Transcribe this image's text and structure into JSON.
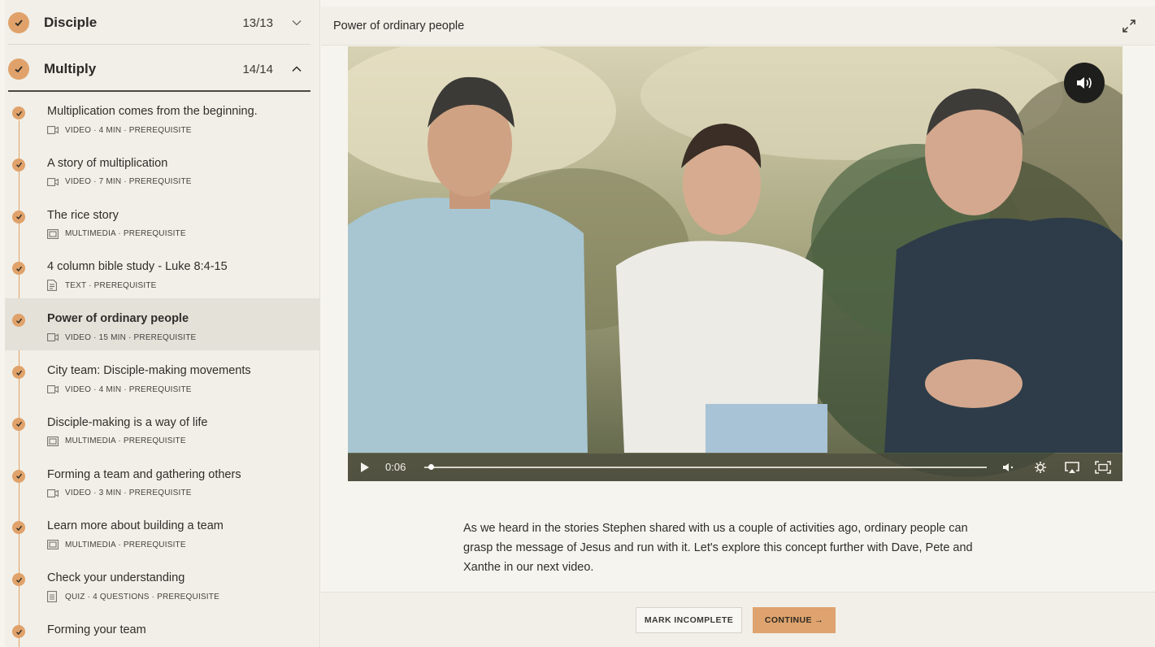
{
  "sidebar": {
    "sections": [
      {
        "title": "Disciple",
        "count": "13/13",
        "expanded": false
      },
      {
        "title": "Multiply",
        "count": "14/14",
        "expanded": true
      }
    ],
    "lessons": [
      {
        "title": "Multiplication comes from the beginning.",
        "meta": "VIDEO · 4 MIN · PREREQUISITE",
        "icon": "video-icon"
      },
      {
        "title": "A story of multiplication",
        "meta": "VIDEO · 7 MIN · PREREQUISITE",
        "icon": "video-icon"
      },
      {
        "title": "The rice story",
        "meta": "MULTIMEDIA · PREREQUISITE",
        "icon": "multimedia-icon"
      },
      {
        "title": "4 column bible study - Luke 8:4-15",
        "meta": "TEXT · PREREQUISITE",
        "icon": "text-icon"
      },
      {
        "title": "Power of ordinary people",
        "meta": "VIDEO · 15 MIN · PREREQUISITE",
        "icon": "video-icon",
        "active": true
      },
      {
        "title": "City team: Disciple-making movements",
        "meta": "VIDEO · 4 MIN · PREREQUISITE",
        "icon": "video-icon"
      },
      {
        "title": "Disciple-making is a way of life",
        "meta": "MULTIMEDIA · PREREQUISITE",
        "icon": "multimedia-icon"
      },
      {
        "title": "Forming a team and gathering others",
        "meta": "VIDEO · 3 MIN · PREREQUISITE",
        "icon": "video-icon"
      },
      {
        "title": "Learn more about building a team",
        "meta": "MULTIMEDIA · PREREQUISITE",
        "icon": "multimedia-icon"
      },
      {
        "title": "Check your understanding",
        "meta": "QUIZ · 4 QUESTIONS · PREREQUISITE",
        "icon": "quiz-icon"
      },
      {
        "title": "Forming your team",
        "meta": "",
        "icon": "text-icon"
      }
    ]
  },
  "main": {
    "page_title": "Power of ordinary people",
    "video": {
      "current_time": "0:06",
      "progress": 0.01
    },
    "description": "As we heard in the stories Stephen shared with us a couple of activities ago, ordinary people can grasp the message of Jesus and run with it. Let's explore this concept further with Dave, Pete and Xanthe in our next video.",
    "buttons": {
      "mark_incomplete": "MARK INCOMPLETE",
      "continue": "CONTINUE →"
    }
  },
  "colors": {
    "accent": "#e0a26a",
    "background": "#f6f4ee",
    "sidebar": "#f1efe8",
    "active_row": "#e4e1d9"
  }
}
